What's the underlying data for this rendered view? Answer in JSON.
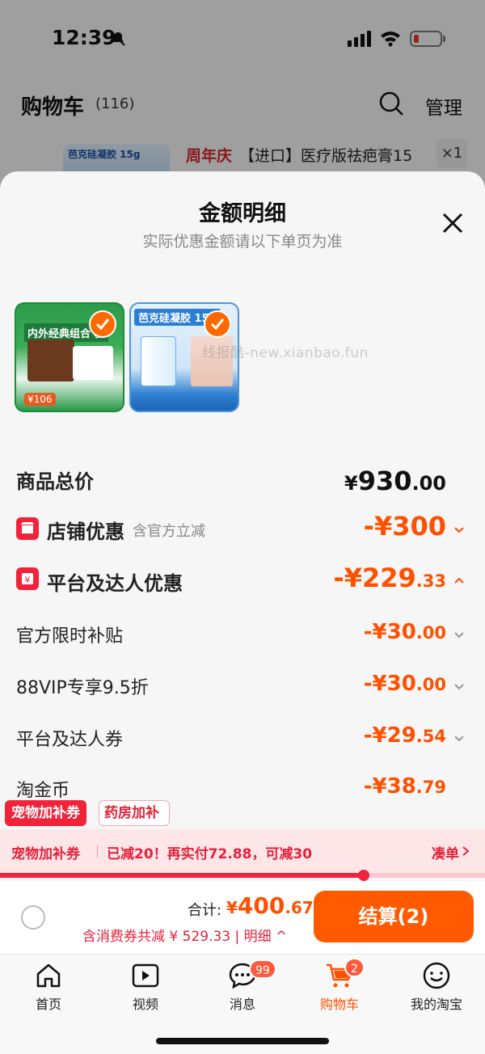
{
  "status": {
    "time": "12:39"
  },
  "background": {
    "title": "购物车",
    "count": "(116)",
    "manage": "管理",
    "item": {
      "thumb_text": "芭克硅凝胶 15g",
      "tag": "周年庆",
      "title": "【进口】医疗版祛疤膏15",
      "qty": "×1"
    }
  },
  "sheet": {
    "title": "金额明细",
    "subtitle": "实际优惠金额请以下单页为准",
    "products": [
      {
        "title": "内外经典组合 驱",
        "price": "¥106"
      },
      {
        "title": "芭克硅凝胶 15g"
      }
    ],
    "watermark": "线报酷-new.xianbao.fun",
    "rows": {
      "total": {
        "label": "商品总价",
        "sym": "¥",
        "int": "930",
        "dec": ".00"
      },
      "shop": {
        "label": "店铺优惠",
        "note": "含官方立减",
        "int": "-¥300",
        "dec": ""
      },
      "platform": {
        "label": "平台及达人优惠",
        "int": "-¥229",
        "dec": ".33"
      },
      "sub": [
        {
          "label": "官方限时补贴",
          "int": "-¥30",
          "dec": ".00"
        },
        {
          "label": "88VIP专享9.5折",
          "int": "-¥30",
          "dec": ".00"
        },
        {
          "label": "平台及达人券",
          "int": "-¥29",
          "dec": ".54"
        },
        {
          "label": "淘金币",
          "int": "-¥38",
          "dec": ".79"
        }
      ]
    },
    "coupon_tabs": [
      "宠物加补券",
      "药房加补"
    ]
  },
  "promo_bar": {
    "label": "宠物加补券",
    "text": "已减20！再实付72.88，可减30",
    "link": "凑单",
    "progress": 0.75
  },
  "checkout": {
    "sum_label": "合计:",
    "sum_sym": "¥",
    "sum_int": "400",
    "sum_dec": ".67",
    "note": "含消费券共减 ¥ 529.33 | 明细 ^",
    "button": "结算(2)"
  },
  "tabbar": {
    "items": [
      {
        "label": "首页",
        "icon": "home-icon"
      },
      {
        "label": "视频",
        "icon": "video-icon"
      },
      {
        "label": "消息",
        "icon": "message-icon",
        "badge": "99"
      },
      {
        "label": "购物车",
        "icon": "cart-icon",
        "badge": "2",
        "active": true
      },
      {
        "label": "我的淘宝",
        "icon": "profile-icon"
      }
    ]
  },
  "colors": {
    "accent": "#ff5000",
    "red": "#f0233b"
  }
}
